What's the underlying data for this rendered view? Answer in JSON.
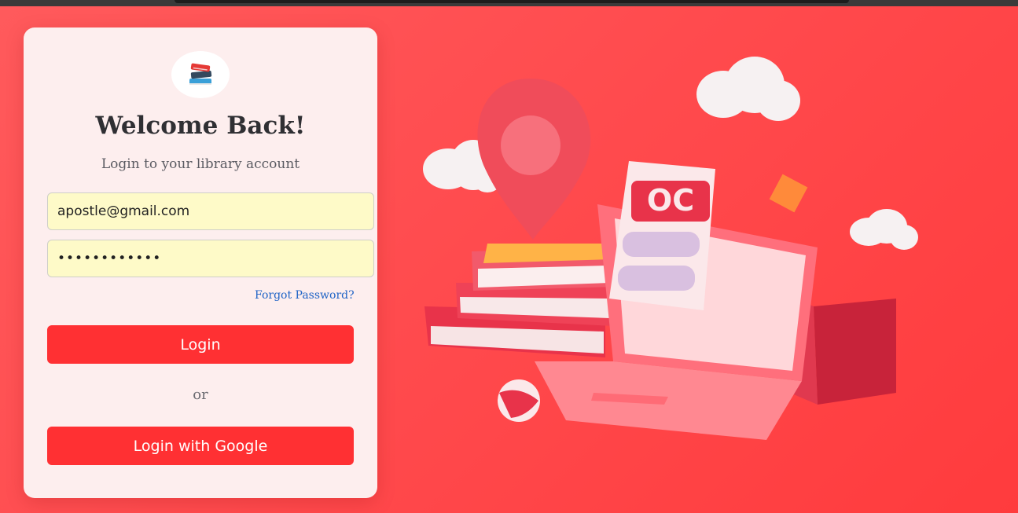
{
  "login": {
    "logo_icon": "books-icon",
    "title": "Welcome Back!",
    "subtitle": "Login to your library account",
    "email_value": "apostle@gmail.com",
    "password_value": "••••••••••••",
    "forgot_link": "Forgot Password?",
    "login_button": "Login",
    "divider_text": "or",
    "google_button": "Login with Google"
  },
  "illustration": {
    "sign_text": "OC"
  },
  "colors": {
    "primary": "#ff3033",
    "background": "#ff4a4d",
    "card": "#fdeeee",
    "input_fill": "#fefac8",
    "link": "#1f63c6"
  }
}
